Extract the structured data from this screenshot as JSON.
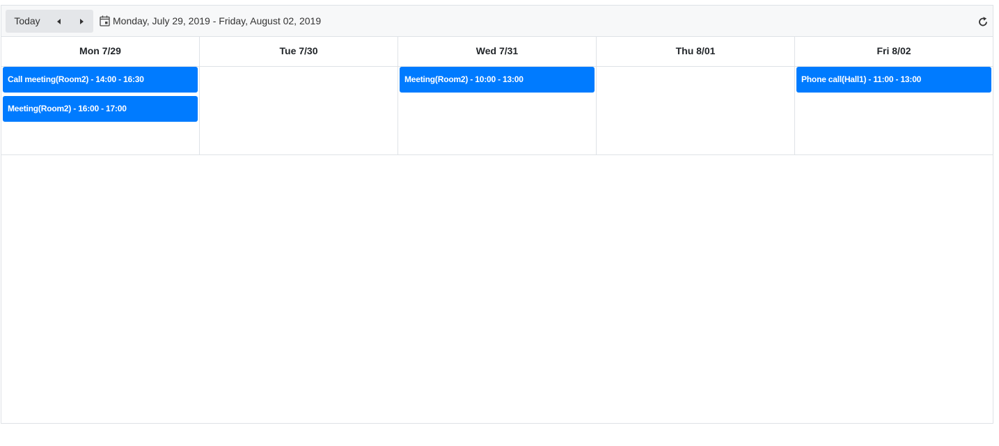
{
  "toolbar": {
    "today_label": "Today",
    "prev_icon": "caret-left-icon",
    "next_icon": "caret-right-icon",
    "calendar_icon": "calendar-icon",
    "date_range": "Monday, July 29, 2019 - Friday, August 02, 2019",
    "refresh_icon": "refresh-icon"
  },
  "days": [
    {
      "label": "Mon 7/29",
      "events": [
        "Call meeting(Room2) - 14:00 - 16:30",
        "Meeting(Room2) - 16:00 - 17:00"
      ]
    },
    {
      "label": "Tue 7/30",
      "events": []
    },
    {
      "label": "Wed 7/31",
      "events": [
        "Meeting(Room2) - 10:00 - 13:00"
      ]
    },
    {
      "label": "Thu 8/01",
      "events": []
    },
    {
      "label": "Fri 8/02",
      "events": [
        "Phone call(Hall1) - 11:00 - 13:00"
      ]
    }
  ],
  "colors": {
    "event": "#007bff",
    "toolbar_bg": "#f7f8f9",
    "nav_bg": "#e4e6e9",
    "border": "#dee2e6"
  }
}
